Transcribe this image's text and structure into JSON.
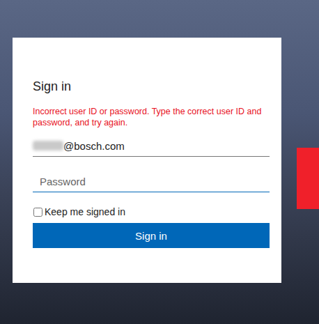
{
  "form": {
    "title": "Sign in",
    "error": "Incorrect user ID or password. Type the correct user ID and password, and try again."
  },
  "fields": [
    {
      "name": "user-id",
      "type": "text",
      "value": "@bosch.com",
      "placeholder": "",
      "focused": false,
      "prefix_blurred": true
    },
    {
      "name": "password",
      "type": "password",
      "value": "",
      "placeholder": "Password",
      "focused": true,
      "prefix_blurred": false
    }
  ],
  "keep_signed_in": {
    "label": "Keep me signed in",
    "checked": false
  },
  "button": "Sign in"
}
